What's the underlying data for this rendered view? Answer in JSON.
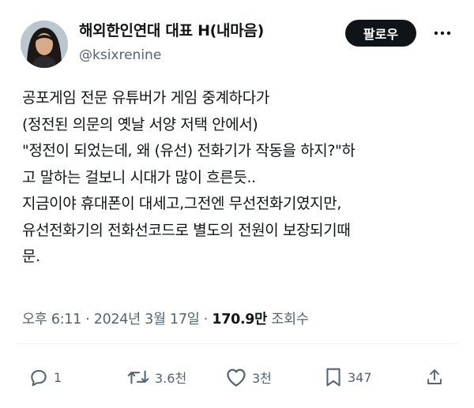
{
  "author": {
    "name": "해외한인연대 대표 H(내마음)",
    "handle": "@ksixrenine"
  },
  "follow_label": "팔로우",
  "tweet": {
    "lines": [
      "공포게임 전문 유튜버가 게임 중계하다가",
      "(정전된 의문의 옛날 서양 저택 안에서)",
      "\"정전이 되었는데, 왜 (유선) 전화기가 작동을 하지?\"하",
      "고 말하는 걸보니 시대가 많이 흐른듯..",
      "지금이야 휴대폰이 대세고,그전엔 무선전화기였지만,",
      "유선전화기의 전화선코드로 별도의 전원이 보장되기때",
      "문."
    ]
  },
  "meta": {
    "time": "오후 6:11",
    "date": "2024년 3월 17일",
    "separator": " · ",
    "views_value": "170.9만",
    "views_label": "조회수"
  },
  "actions": {
    "reply_count": "1",
    "retweet_count": "3.6천",
    "like_count": "3천",
    "bookmark_count": "347"
  },
  "icons": [
    "avatar-photo",
    "more-icon",
    "reply-icon",
    "retweet-icon",
    "like-icon",
    "bookmark-icon",
    "share-icon"
  ],
  "colors": {
    "text": "#0f1419",
    "secondary": "#536471",
    "button_bg": "#0f1419",
    "button_text": "#ffffff"
  }
}
